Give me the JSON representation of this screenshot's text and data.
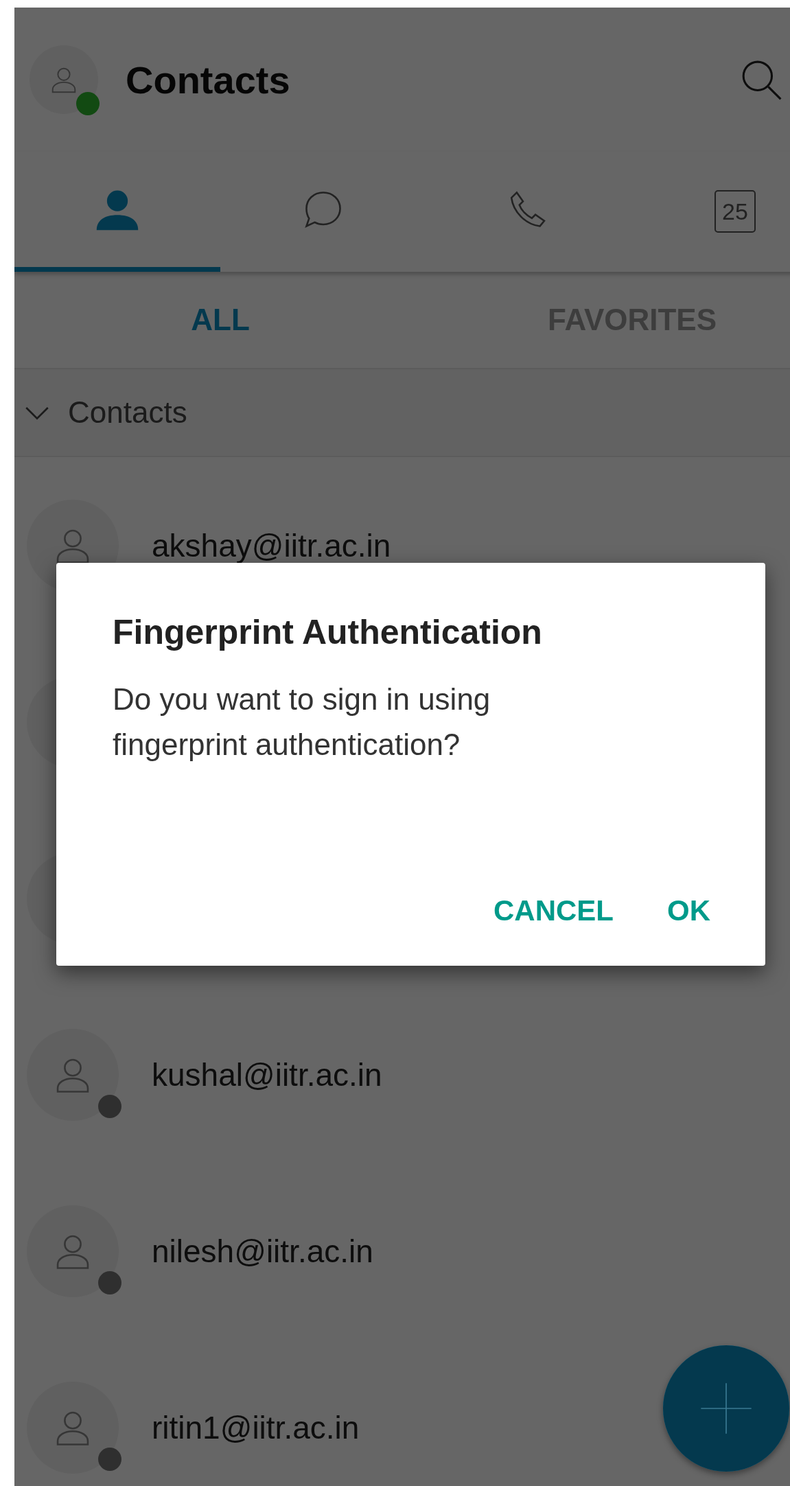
{
  "header": {
    "title": "Contacts",
    "online": true
  },
  "tabs": [
    {
      "kind": "person",
      "selected": true
    },
    {
      "kind": "chat",
      "selected": false
    },
    {
      "kind": "phone",
      "selected": false
    },
    {
      "kind": "calendar",
      "label": "25",
      "selected": false
    }
  ],
  "subtabs": [
    {
      "label": "ALL",
      "selected": true
    },
    {
      "label": "FAVORITES",
      "selected": false
    }
  ],
  "group": {
    "label": "Contacts",
    "expanded": true
  },
  "contacts": [
    {
      "kind": "contact",
      "name": "akshay@iitr.ac.in"
    },
    {
      "kind": "obscured"
    },
    {
      "kind": "obscured"
    },
    {
      "kind": "contact",
      "name": "kushal@iitr.ac.in"
    },
    {
      "kind": "contact",
      "name": "nilesh@iitr.ac.in"
    },
    {
      "kind": "contact",
      "name": "ritin1@iitr.ac.in"
    }
  ],
  "dialog": {
    "title": "Fingerprint Authentication",
    "message": "Do you want to sign in using fingerprint authentication?",
    "buttons": [
      "CANCEL",
      "OK"
    ]
  }
}
